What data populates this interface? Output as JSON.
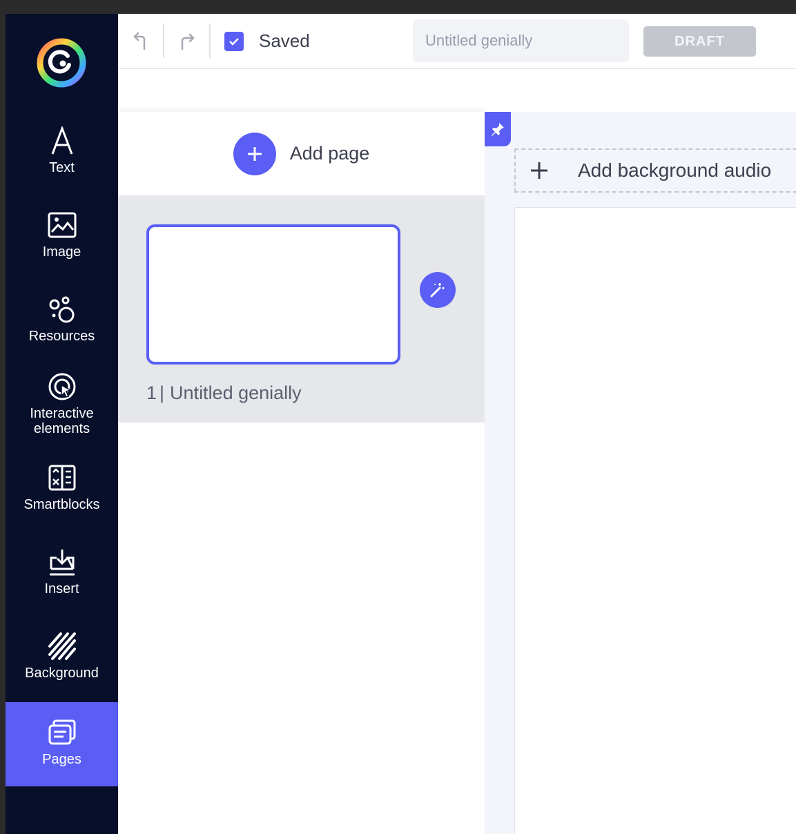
{
  "colors": {
    "sidebar_bg": "#070f2b",
    "accent": "#5a5ef5",
    "draft_bg": "#c4c6cd"
  },
  "sidebar": {
    "logo_icon": "genially-logo-icon",
    "items": [
      {
        "label": "Text",
        "icon": "text-icon",
        "active": false
      },
      {
        "label": "Image",
        "icon": "image-icon",
        "active": false
      },
      {
        "label": "Resources",
        "icon": "resources-icon",
        "active": false
      },
      {
        "label": "Interactive elements",
        "icon": "interactive-icon",
        "active": false
      },
      {
        "label": "Smartblocks",
        "icon": "smartblocks-icon",
        "active": false
      },
      {
        "label": "Insert",
        "icon": "insert-icon",
        "active": false
      },
      {
        "label": "Background",
        "icon": "background-icon",
        "active": false
      },
      {
        "label": "Pages",
        "icon": "pages-icon",
        "active": true
      }
    ]
  },
  "topbar": {
    "undo_icon": "undo-icon",
    "redo_icon": "redo-icon",
    "saved_label": "Saved",
    "title_placeholder": "Untitled genially",
    "draft_label": "DRAFT"
  },
  "pages_panel": {
    "add_page_label": "Add page",
    "pages": [
      {
        "number": "1",
        "name": "Untitled genially"
      }
    ]
  },
  "canvas": {
    "add_audio_label": "Add background audio"
  }
}
